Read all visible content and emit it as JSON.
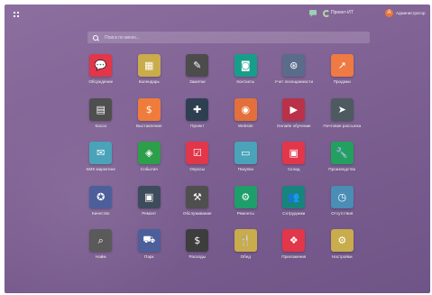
{
  "topbar": {
    "company": "Проект-ИТ",
    "user": "Администратор",
    "avatar_letter": "A"
  },
  "search": {
    "placeholder": "Поиск по меню..."
  },
  "apps": [
    {
      "label": "Обсуждение",
      "icon": "chat-bubble-icon",
      "glyph": "💬",
      "color": "#e2364a"
    },
    {
      "label": "Календарь",
      "icon": "calendar-icon",
      "glyph": "▦",
      "color": "#c9ac4b"
    },
    {
      "label": "Заметки",
      "icon": "notes-icon",
      "glyph": "✎",
      "color": "#4c4c4c"
    },
    {
      "label": "Контакты",
      "icon": "contacts-icon",
      "glyph": "◙",
      "color": "#179e8a"
    },
    {
      "label": "Учет посещаемости",
      "icon": "handshake-icon",
      "glyph": "⊛",
      "color": "#5b6b8a"
    },
    {
      "label": "Продажи",
      "icon": "trend-chart-icon",
      "glyph": "↗",
      "color": "#ef7a44"
    },
    {
      "label": "Касса",
      "icon": "cash-register-icon",
      "glyph": "▤",
      "color": "#4f4f4f"
    },
    {
      "label": "Выставление",
      "icon": "invoice-icon",
      "glyph": "$",
      "color": "#f07c3c"
    },
    {
      "label": "Проект",
      "icon": "puzzle-icon",
      "glyph": "✚",
      "color": "#2f3f52"
    },
    {
      "label": "Website",
      "icon": "globe-icon",
      "glyph": "◉",
      "color": "#e3703a"
    },
    {
      "label": "Онлайн обучение",
      "icon": "elearning-icon",
      "glyph": "▶",
      "color": "#b9324a"
    },
    {
      "label": "Почтовая рассылка",
      "icon": "paper-plane-icon",
      "glyph": "➤",
      "color": "#4d5a5f"
    },
    {
      "label": "SMS маркетинг",
      "icon": "sms-icon",
      "glyph": "✉",
      "color": "#4aa3b8"
    },
    {
      "label": "События",
      "icon": "ticket-icon",
      "glyph": "◈",
      "color": "#2d9e4a"
    },
    {
      "label": "Опросы",
      "icon": "survey-icon",
      "glyph": "☑",
      "color": "#e2364a"
    },
    {
      "label": "Покупки",
      "icon": "credit-card-icon",
      "glyph": "▭",
      "color": "#4aa3b8"
    },
    {
      "label": "Склад",
      "icon": "box-icon",
      "glyph": "▣",
      "color": "#e2364a"
    },
    {
      "label": "Производство",
      "icon": "wrench-icon",
      "glyph": "🔧",
      "color": "#23a05f"
    },
    {
      "label": "Качество",
      "icon": "award-icon",
      "glyph": "✪",
      "color": "#4c5f9b"
    },
    {
      "label": "Ремонт",
      "icon": "repair-box-icon",
      "glyph": "▣",
      "color": "#3d4b5c"
    },
    {
      "label": "Обслуживание",
      "icon": "hammer-icon",
      "glyph": "⚒",
      "color": "#4f4f4f"
    },
    {
      "label": "Ремонты",
      "icon": "tools-icon",
      "glyph": "⚙",
      "color": "#1e9e6a"
    },
    {
      "label": "Сотрудники",
      "icon": "team-icon",
      "glyph": "👥",
      "color": "#17857c"
    },
    {
      "label": "Отсутствия",
      "icon": "time-off-icon",
      "glyph": "◷",
      "color": "#4a8db5"
    },
    {
      "label": "Найм",
      "icon": "magnifier-icon",
      "glyph": "⌕",
      "color": "#5a5a5a"
    },
    {
      "label": "Парк",
      "icon": "car-icon",
      "glyph": "⛟",
      "color": "#4c5f9b"
    },
    {
      "label": "Расходы",
      "icon": "expenses-icon",
      "glyph": "$",
      "color": "#3d3d3d"
    },
    {
      "label": "Обед",
      "icon": "cutlery-icon",
      "glyph": "🍴",
      "color": "#c9ac4b"
    },
    {
      "label": "Приложения",
      "icon": "apps-cubes-icon",
      "glyph": "❖",
      "color": "#e2364a"
    },
    {
      "label": "Настройки",
      "icon": "gear-icon",
      "glyph": "⚙",
      "color": "#c9ac4b"
    }
  ]
}
